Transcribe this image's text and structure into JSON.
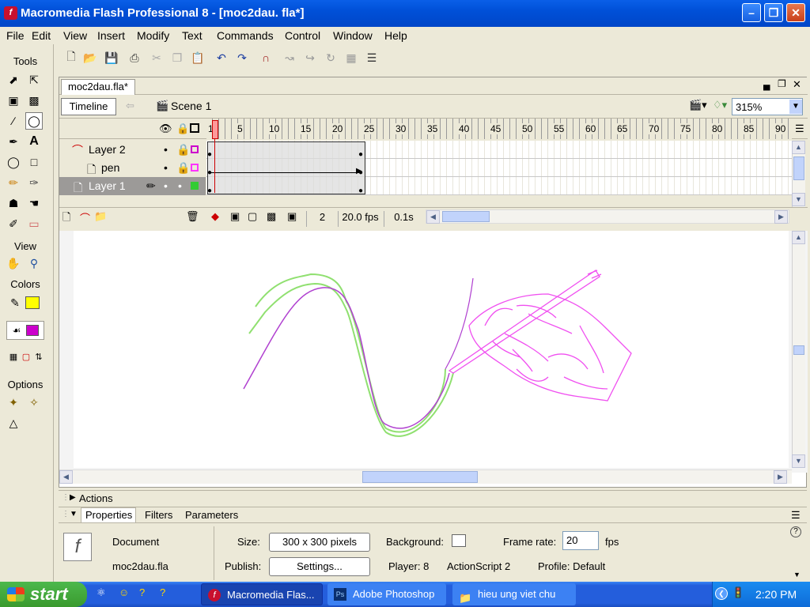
{
  "window": {
    "title": "Macromedia Flash Professional 8 - [moc2dau. fla*]"
  },
  "menu": [
    "File",
    "Edit",
    "View",
    "Insert",
    "Modify",
    "Text",
    "Commands",
    "Control",
    "Window",
    "Help"
  ],
  "tools": {
    "header": "Tools",
    "view_header": "View",
    "colors_header": "Colors",
    "options_header": "Options",
    "stroke_color": "#000000",
    "stroke_swatch": "#FFFF00",
    "fill_swatch": "#CC00CC"
  },
  "document": {
    "tab_label": "moc2dau.fla*",
    "timeline_button": "Timeline",
    "scene_label": "Scene 1",
    "zoom": "315%"
  },
  "timeline": {
    "ruler": [
      "1",
      "5",
      "10",
      "15",
      "20",
      "25",
      "30",
      "35",
      "40",
      "45",
      "50",
      "55",
      "60",
      "65",
      "70",
      "75",
      "80",
      "85",
      "90"
    ],
    "layers": [
      {
        "name": "Layer 2",
        "type": "guide",
        "outline_color": "#CC00CC",
        "selected": false
      },
      {
        "name": "pen",
        "type": "guided",
        "outline_color": "#FF33FF",
        "selected": false
      },
      {
        "name": "Layer 1",
        "type": "normal",
        "outline_color": "#33CC33",
        "selected": true
      }
    ],
    "current_frame": "2",
    "frame_rate": "20.0 fps",
    "elapsed": "0.1s"
  },
  "panels": {
    "actions": "Actions",
    "tabs": [
      "Properties",
      "Filters",
      "Parameters"
    ]
  },
  "properties": {
    "type": "Document",
    "filename": "moc2dau.fla",
    "size_label": "Size:",
    "size_value": "300 x 300 pixels",
    "publish_label": "Publish:",
    "settings_button": "Settings...",
    "background_label": "Background:",
    "player": "Player: 8",
    "actionscript": "ActionScript  2",
    "profile": "Profile:  Default",
    "frame_rate_label": "Frame rate:",
    "frame_rate_value": "20",
    "fps_label": "fps"
  },
  "taskbar": {
    "start": "start",
    "tasks": [
      "Macromedia Flas...",
      "Adobe Photoshop",
      "hieu ung viet chu"
    ],
    "clock": "2:20 PM"
  }
}
